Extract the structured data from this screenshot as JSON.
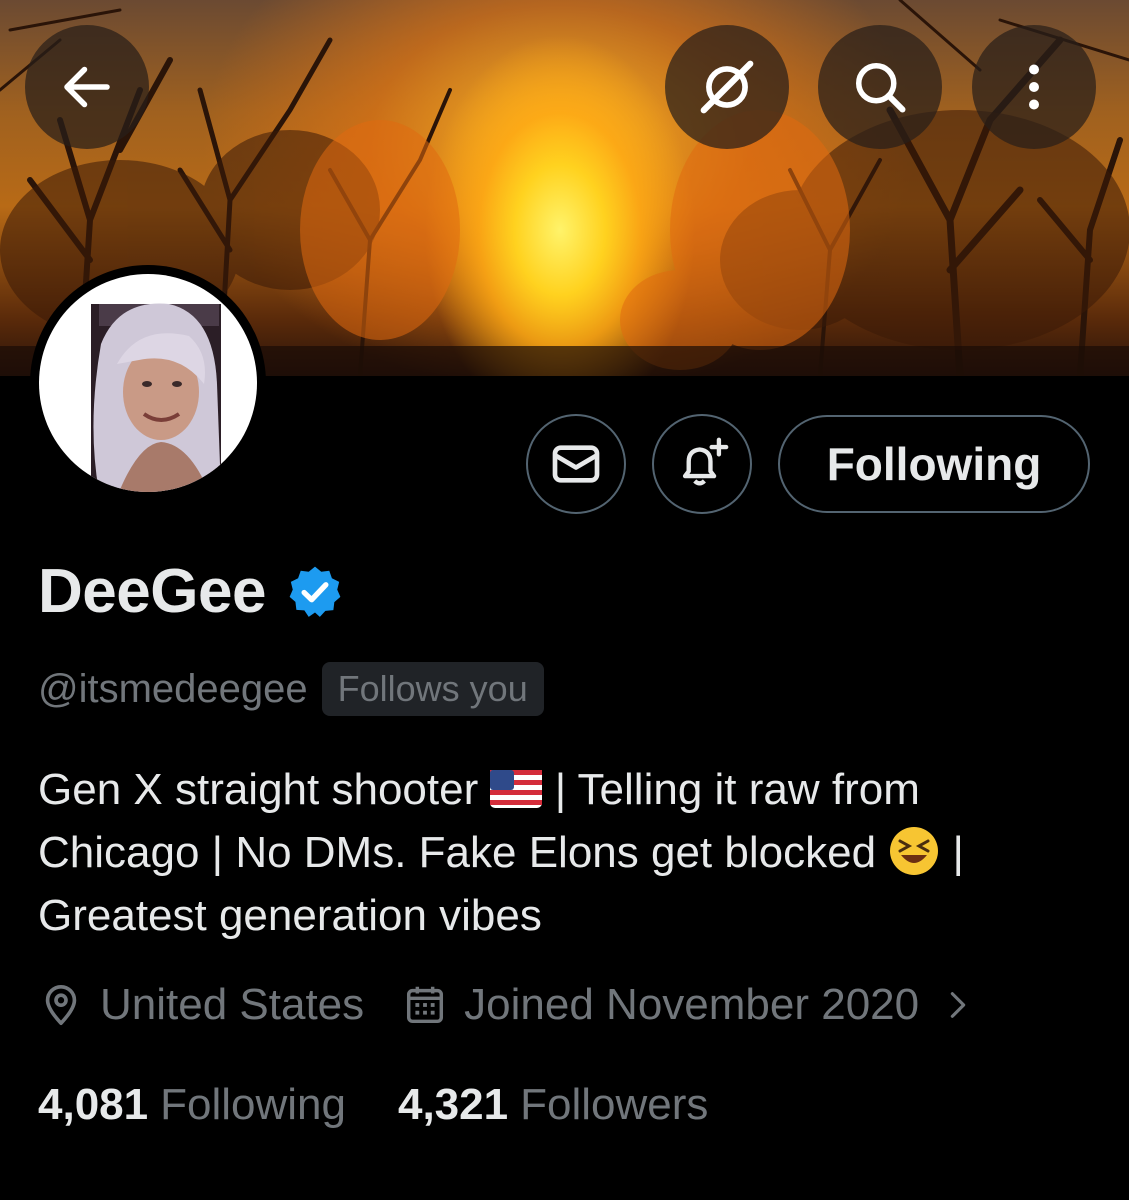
{
  "header": {
    "back_icon": "arrow-left-icon",
    "grok_icon": "grok-icon",
    "search_icon": "search-icon",
    "more_icon": "more-vertical-icon"
  },
  "profile": {
    "display_name": "DeeGee",
    "verified": true,
    "verified_color": "#1d9bf0",
    "handle": "@itsmedeegee",
    "follows_you_label": "Follows you",
    "bio_part1": "Gen X straight shooter ",
    "bio_part2": " | Telling it raw from Chicago | No DMs. Fake Elons get blocked ",
    "bio_part3": " | Greatest generation vibes",
    "location": "United States",
    "joined": "Joined November 2020",
    "following_count": "4,081",
    "following_label": "Following",
    "followers_count": "4,321",
    "followers_label": "Followers"
  },
  "actions": {
    "message_icon": "mail-icon",
    "notify_icon": "bell-plus-icon",
    "following_button_label": "Following"
  }
}
